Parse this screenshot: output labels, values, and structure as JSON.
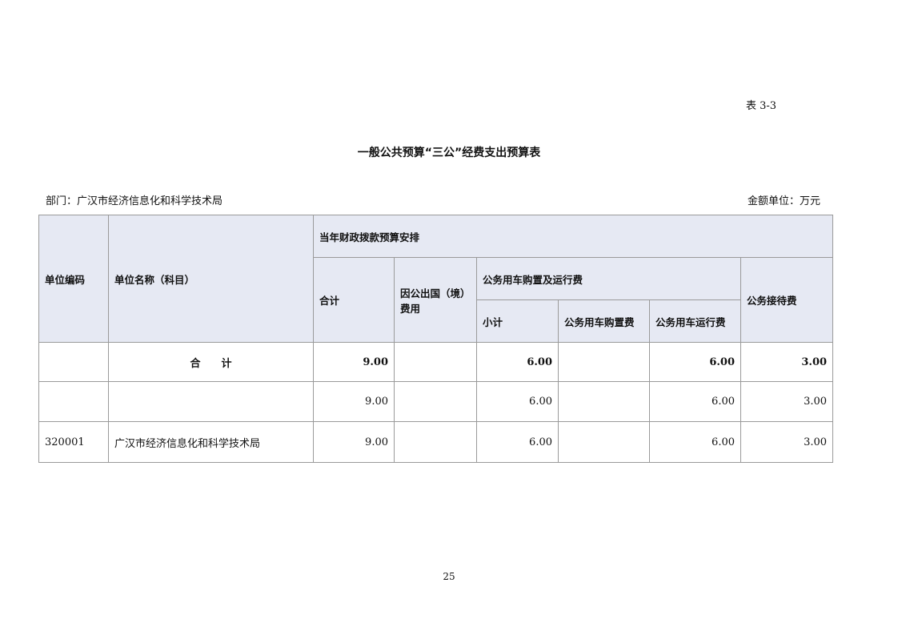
{
  "table_number": "表 3-3",
  "title": "一般公共预算“三公”经费支出预算表",
  "department": "部门：广汉市经济信息化和科学技术局",
  "amount_unit": "金额单位：万元",
  "headers": {
    "unit_code": "单位编码",
    "unit_name": "单位名称（科目）",
    "current_year": "当年财政拨款预算安排",
    "total": "合计",
    "overseas": "因公出国（境）费用",
    "vehicle": "公务用车购置及运行费",
    "subtotal": "小计",
    "vehicle_purchase": "公务用车购置费",
    "vehicle_operation": "公务用车运行费",
    "reception": "公务接待费"
  },
  "rows": [
    {
      "code": "",
      "name": "合　　计",
      "total": "9.00",
      "overseas": "",
      "subtotal": "6.00",
      "purchase": "",
      "operation": "6.00",
      "reception": "3.00"
    },
    {
      "code": "",
      "name": "",
      "total": "9.00",
      "overseas": "",
      "subtotal": "6.00",
      "purchase": "",
      "operation": "6.00",
      "reception": "3.00"
    },
    {
      "code": "320001",
      "name": "广汉市经济信息化和科学技术局",
      "total": "9.00",
      "overseas": "",
      "subtotal": "6.00",
      "purchase": "",
      "operation": "6.00",
      "reception": "3.00"
    }
  ],
  "page_number": "25"
}
